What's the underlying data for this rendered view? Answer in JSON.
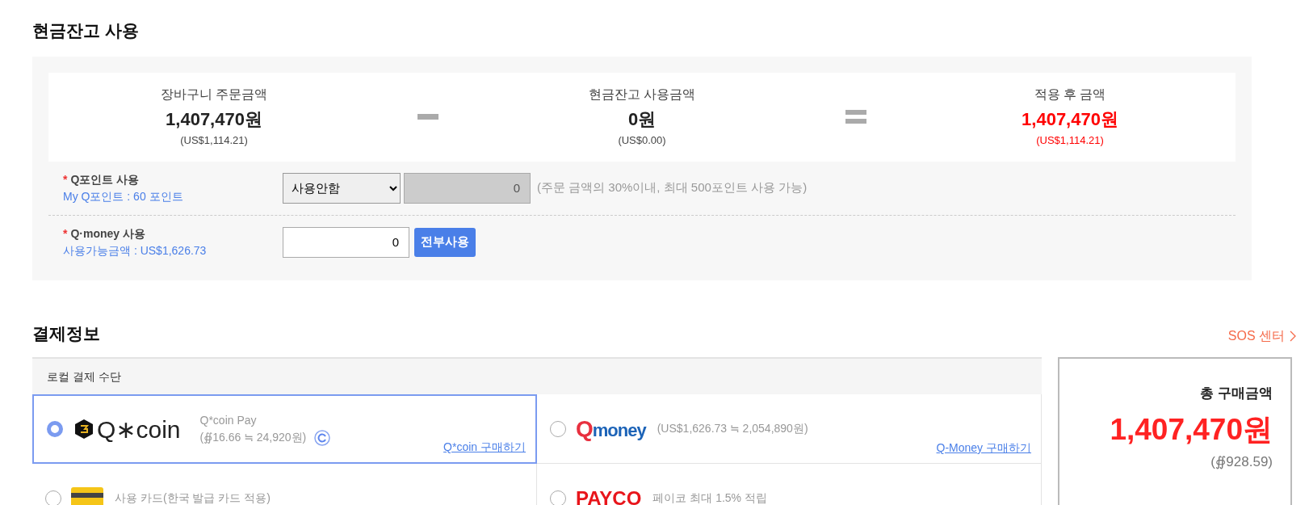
{
  "cash_balance": {
    "title": "현금잔고 사용",
    "summary": [
      {
        "kind": "amount",
        "label": "장바구니 주문금액",
        "amount": "1,407,470원",
        "usd": "(US$1,114.21)",
        "highlight": false
      },
      {
        "kind": "minus"
      },
      {
        "kind": "amount",
        "label": "현금잔고 사용금액",
        "amount": "0원",
        "usd": "(US$0.00)",
        "highlight": false
      },
      {
        "kind": "equals"
      },
      {
        "kind": "amount",
        "label": "적용 후 금액",
        "amount": "1,407,470원",
        "usd": "(US$1,114.21)",
        "highlight": true
      }
    ],
    "q_point": {
      "required_mark": "*",
      "label": "Q포인트 사용",
      "sub": "My Q포인트 : 60 포인트",
      "select_value": "사용안함",
      "value": "0",
      "disabled": true,
      "note": "(주문 금액의 30%이내, 최대 500포인트 사용 가능)"
    },
    "q_money": {
      "required_mark": "*",
      "label": "Q·money 사용",
      "sub": "사용가능금액 : US$1,626.73",
      "value": "0",
      "disabled": false,
      "button": "전부사용"
    }
  },
  "payment": {
    "title": "결제정보",
    "sos": "SOS 센터",
    "local_header": "로컬 결제 수단",
    "methods": [
      {
        "kind": "qcoin",
        "selected": true,
        "logo": "Q∗coin",
        "name": "Q*coin Pay",
        "detail": "(∯16.66 ≒ 24,920원)",
        "link": "Q*coin 구매하기"
      },
      {
        "kind": "qmoney",
        "selected": false,
        "logo_mark": "Q",
        "logo": "money",
        "detail": "(US$1,626.73 ≒ 2,054,890원)",
        "link": "Q-Money 구매하기"
      },
      {
        "kind": "card",
        "selected": false,
        "name": "사용 카드(한국 발급 카드 적용)"
      },
      {
        "kind": "payco",
        "selected": false,
        "logo": "PAYCO",
        "name": "페이코 최대 1.5% 적립"
      }
    ],
    "total": {
      "label": "총 구매금액",
      "amount": "1,407,470원",
      "sub": "(∯928.59)"
    }
  }
}
